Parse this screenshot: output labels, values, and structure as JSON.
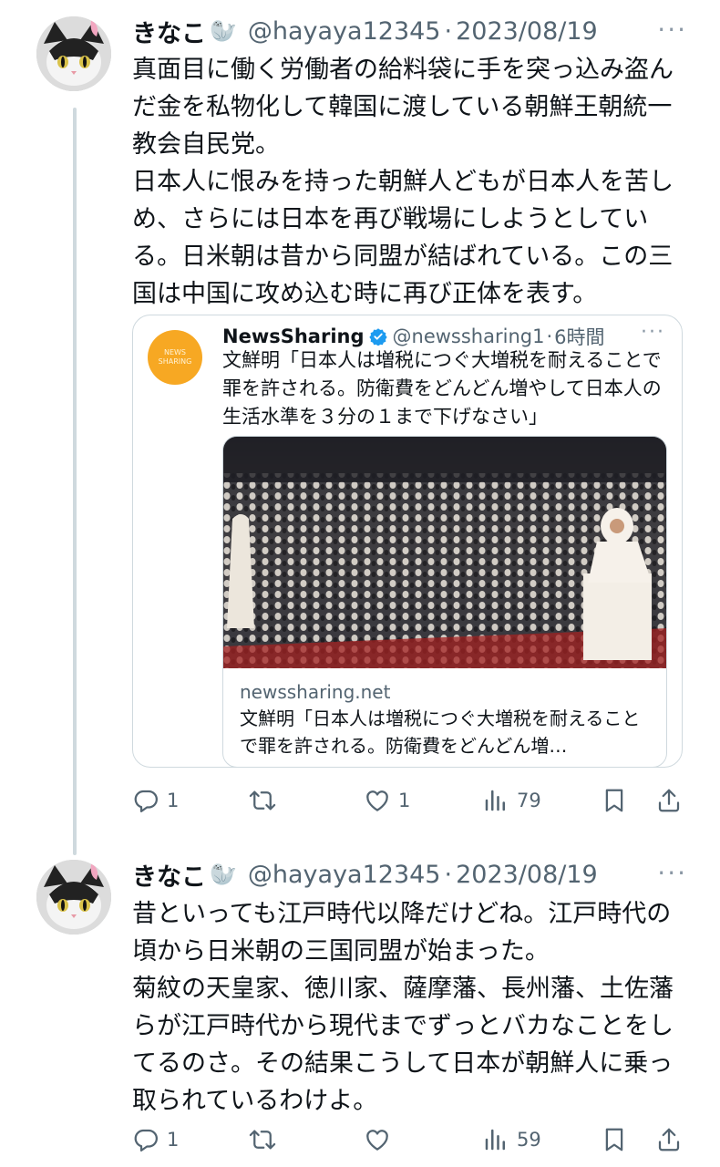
{
  "tweets": [
    {
      "author": "きなこ",
      "badge": "🦭",
      "handle": "@hayaya12345",
      "separator": "·",
      "date": "2023/08/19",
      "more": "···",
      "text": "真面目に働く労働者の給料袋に手を突っ込み盗んだ金を私物化して韓国に渡している朝鮮王朝統一教会自民党。\n日本人に恨みを持った朝鮮人どもが日本人を苦しめ、さらには日本を再び戦場にしようとしている。日米朝は昔から同盟が結ばれている。この三国は中国に攻め込む時に再び正体を表す。",
      "quote": {
        "avatar_text": "NEWS SHARING",
        "name": "NewsSharing",
        "handle": "@newssharing1",
        "separator": "·",
        "time": "6時間",
        "more": "···",
        "text": "文鮮明「日本人は増税につぐ大増税を耐えることで罪を許される。防衛費をどんどん増やして日本人の生活水準を３分の１まで下げなさい」",
        "card": {
          "domain": "newssharing.net",
          "title": "文鮮明「日本人は増税につぐ大増税を耐えることで罪を許される。防衛費をどんどん増…"
        }
      },
      "actions": {
        "replies": "1",
        "retweets": "",
        "likes": "1",
        "views": "79"
      }
    },
    {
      "author": "きなこ",
      "badge": "🦭",
      "handle": "@hayaya12345",
      "separator": "·",
      "date": "2023/08/19",
      "more": "···",
      "text": "昔といっても江戸時代以降だけどね。江戸時代の頃から日米朝の三国同盟が始まった。\n菊紋の天皇家、徳川家、薩摩藩、長州藩、土佐藩らが江戸時代から現代までずっとバカなことをしてるのさ。その結果こうして日本が朝鮮人に乗っ取られているわけよ。",
      "actions": {
        "replies": "1",
        "retweets": "",
        "likes": "",
        "views": "59"
      }
    }
  ],
  "colors": {
    "text": "#0f1419",
    "muted": "#536471",
    "border": "#cfd9de",
    "verified": "#1d9bf0",
    "news_logo": "#f7a823"
  },
  "icons": [
    "reply-icon",
    "retweet-icon",
    "like-icon",
    "views-icon",
    "bookmark-icon",
    "share-icon",
    "verified-badge-icon"
  ]
}
